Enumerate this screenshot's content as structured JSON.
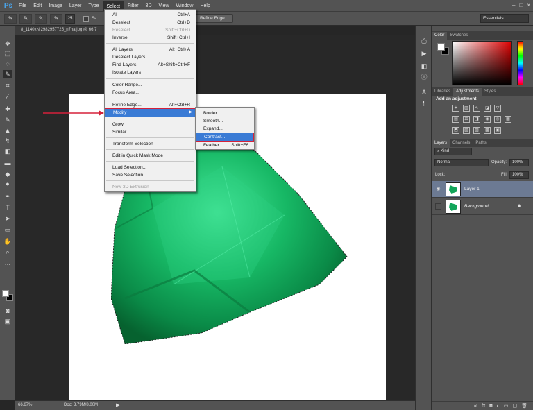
{
  "menubar": {
    "logo": "Ps",
    "items": [
      "File",
      "Edit",
      "Image",
      "Layer",
      "Type",
      "Select",
      "Filter",
      "3D",
      "View",
      "Window",
      "Help"
    ],
    "active": "Select",
    "window_controls": [
      "–",
      "□",
      "×"
    ]
  },
  "options": {
    "brush_size": "25",
    "check_label": "Sa",
    "refine_button": "Refine Edge...",
    "workspace": "Essentials"
  },
  "document": {
    "tab_title": "8_1140xN.2982957725_n7ha.jpg @ 66.7",
    "zoom": "66.67%",
    "doc_info": "Doc: 3.79M/8.00M",
    "status_arrow": "▶"
  },
  "select_menu": {
    "items": [
      {
        "label": "All",
        "shortcut": "Ctrl+A"
      },
      {
        "label": "Deselect",
        "shortcut": "Ctrl+D"
      },
      {
        "label": "Reselect",
        "shortcut": "Shift+Ctrl+D"
      },
      {
        "label": "Inverse",
        "shortcut": "Shift+Ctrl+I"
      },
      {
        "label": "All Layers",
        "shortcut": "Alt+Ctrl+A"
      },
      {
        "label": "Deselect Layers",
        "shortcut": ""
      },
      {
        "label": "Find Layers",
        "shortcut": "Alt+Shift+Ctrl+F"
      },
      {
        "label": "Isolate Layers",
        "shortcut": ""
      },
      {
        "label": "Color Range...",
        "shortcut": ""
      },
      {
        "label": "Focus Area...",
        "shortcut": ""
      },
      {
        "label": "Refine Edge...",
        "shortcut": "Alt+Ctrl+R"
      },
      {
        "label": "Modify",
        "shortcut": ""
      },
      {
        "label": "Grow",
        "shortcut": ""
      },
      {
        "label": "Similar",
        "shortcut": ""
      },
      {
        "label": "Transform Selection",
        "shortcut": ""
      },
      {
        "label": "Edit in Quick Mask Mode",
        "shortcut": ""
      },
      {
        "label": "Load Selection...",
        "shortcut": ""
      },
      {
        "label": "Save Selection...",
        "shortcut": ""
      },
      {
        "label": "New 3D Extrusion",
        "shortcut": ""
      }
    ]
  },
  "modify_menu": {
    "items": [
      {
        "label": "Border...",
        "shortcut": ""
      },
      {
        "label": "Smooth...",
        "shortcut": ""
      },
      {
        "label": "Expand...",
        "shortcut": ""
      },
      {
        "label": "Contract...",
        "shortcut": ""
      },
      {
        "label": "Feather...",
        "shortcut": "Shift+F6"
      }
    ]
  },
  "panels": {
    "color_tabs": [
      "Color",
      "Swatches"
    ],
    "adj_tabs": [
      "Libraries",
      "Adjustments",
      "Styles"
    ],
    "adj_title": "Add an adjustment",
    "layer_tabs": [
      "Layers",
      "Channels",
      "Paths"
    ],
    "kind": "Kind",
    "blend_mode": "Normal",
    "opacity_label": "Opacity:",
    "opacity": "100%",
    "lock_label": "Lock:",
    "fill_label": "Fill:",
    "fill": "100%",
    "layers": [
      {
        "name": "Layer 1",
        "visible": true,
        "selected": true
      },
      {
        "name": "Background",
        "visible": false,
        "selected": false
      }
    ]
  },
  "colors": {
    "accent": "#3a7bd5",
    "highlight_outline": "#d5213a",
    "emerald": "#12a55a"
  }
}
